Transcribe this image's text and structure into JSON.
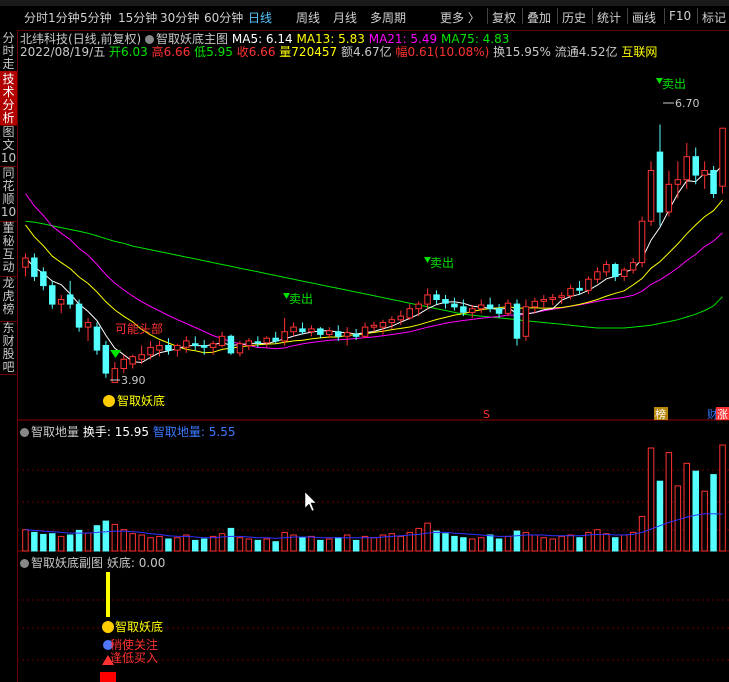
{
  "toolbar": {
    "periods": [
      "分时",
      "1分钟",
      "5分钟",
      "15分钟",
      "30分钟",
      "60分钟",
      "日线",
      "周线",
      "月线",
      "多周期",
      "更多 〉"
    ],
    "active_period": "日线",
    "tools": [
      "复权",
      "叠加",
      "历史",
      "统计",
      "画线",
      "F10",
      "标记"
    ]
  },
  "sidebar": {
    "tabs": [
      "分时走势",
      "技术分析",
      "图文10",
      "同花顺10",
      "董秘互动",
      "龙虎榜",
      "东财股吧"
    ],
    "active": "技术分析"
  },
  "header": {
    "stock": "北纬科技",
    "mode": "(日线,前复权)",
    "indicator": "智取妖底主图",
    "ma5": "MA5: 6.14",
    "ma13": "MA13: 5.83",
    "ma21": "MA21: 5.49",
    "ma75": "MA75: 4.83"
  },
  "quote": {
    "date": "2022/08/19/五",
    "open": "开6.03",
    "high": "高6.66",
    "low": "低5.95",
    "close": "收6.66",
    "volume": "量720457",
    "amount": "额4.67亿",
    "change": "幅0.61(10.08%)",
    "turnover": "换15.95%",
    "float_cap": "流通4.52亿",
    "sector": "互联网"
  },
  "vol_header": {
    "name": "智取地量",
    "turnover": "换手: 15.95",
    "label": "智取地量:",
    "value": "5.55"
  },
  "sub_header": {
    "name": "智取妖底副图",
    "label": "妖底:",
    "value": "0.00"
  },
  "colors": {
    "up": "#ff3232",
    "down": "#54ffff",
    "ma5": "#ffffff",
    "ma13": "#ffff00",
    "ma21": "#ff00ff",
    "ma75": "#00e400",
    "grid": "#6b0000",
    "avg": "#3232ff"
  },
  "chart_data": [
    {
      "type": "candlestick",
      "title": "智取妖底主图",
      "series_names": [
        "MA5",
        "MA13",
        "MA21",
        "MA75"
      ],
      "ylim": [
        3.6,
        7.4
      ],
      "ohlc": [
        [
          5.15,
          5.3,
          5.05,
          5.25
        ],
        [
          5.25,
          5.3,
          5.0,
          5.05
        ],
        [
          5.1,
          5.15,
          4.9,
          4.95
        ],
        [
          4.95,
          5.0,
          4.7,
          4.75
        ],
        [
          4.75,
          4.85,
          4.65,
          4.8
        ],
        [
          4.85,
          5.0,
          4.7,
          4.75
        ],
        [
          4.75,
          4.8,
          4.45,
          4.5
        ],
        [
          4.5,
          4.6,
          4.35,
          4.55
        ],
        [
          4.5,
          4.55,
          4.2,
          4.25
        ],
        [
          4.3,
          4.35,
          3.95,
          4.0
        ],
        [
          3.9,
          4.12,
          3.9,
          4.05
        ],
        [
          4.05,
          4.2,
          4.0,
          4.15
        ],
        [
          4.1,
          4.2,
          4.05,
          4.18
        ],
        [
          4.15,
          4.3,
          4.1,
          4.2
        ],
        [
          4.2,
          4.35,
          4.15,
          4.28
        ],
        [
          4.25,
          4.35,
          4.18,
          4.3
        ],
        [
          4.3,
          4.38,
          4.2,
          4.25
        ],
        [
          4.25,
          4.32,
          4.18,
          4.3
        ],
        [
          4.28,
          4.4,
          4.22,
          4.35
        ],
        [
          4.32,
          4.4,
          4.25,
          4.3
        ],
        [
          4.3,
          4.36,
          4.2,
          4.28
        ],
        [
          4.28,
          4.35,
          4.2,
          4.32
        ],
        [
          4.3,
          4.45,
          4.28,
          4.4
        ],
        [
          4.4,
          4.42,
          4.2,
          4.22
        ],
        [
          4.22,
          4.35,
          4.18,
          4.32
        ],
        [
          4.3,
          4.38,
          4.25,
          4.35
        ],
        [
          4.34,
          4.4,
          4.28,
          4.33
        ],
        [
          4.33,
          4.4,
          4.28,
          4.38
        ],
        [
          4.38,
          4.45,
          4.32,
          4.35
        ],
        [
          4.35,
          4.6,
          4.3,
          4.45
        ],
        [
          4.45,
          4.55,
          4.4,
          4.5
        ],
        [
          4.48,
          4.55,
          4.42,
          4.45
        ],
        [
          4.45,
          4.52,
          4.4,
          4.48
        ],
        [
          4.48,
          4.5,
          4.38,
          4.42
        ],
        [
          4.42,
          4.5,
          4.38,
          4.46
        ],
        [
          4.45,
          4.52,
          4.35,
          4.4
        ],
        [
          4.4,
          4.5,
          4.3,
          4.44
        ],
        [
          4.42,
          4.48,
          4.36,
          4.4
        ],
        [
          4.4,
          4.55,
          4.38,
          4.5
        ],
        [
          4.5,
          4.56,
          4.45,
          4.52
        ],
        [
          4.5,
          4.58,
          4.42,
          4.55
        ],
        [
          4.55,
          4.62,
          4.48,
          4.58
        ],
        [
          4.58,
          4.68,
          4.52,
          4.62
        ],
        [
          4.6,
          4.75,
          4.58,
          4.7
        ],
        [
          4.7,
          4.78,
          4.62,
          4.75
        ],
        [
          4.75,
          4.92,
          4.7,
          4.85
        ],
        [
          4.85,
          4.9,
          4.75,
          4.8
        ],
        [
          4.8,
          4.85,
          4.7,
          4.76
        ],
        [
          4.75,
          4.82,
          4.68,
          4.72
        ],
        [
          4.72,
          4.8,
          4.62,
          4.66
        ],
        [
          4.66,
          4.74,
          4.6,
          4.7
        ],
        [
          4.7,
          4.8,
          4.65,
          4.74
        ],
        [
          4.74,
          4.82,
          4.66,
          4.7
        ],
        [
          4.7,
          4.75,
          4.6,
          4.65
        ],
        [
          4.65,
          4.8,
          4.62,
          4.76
        ],
        [
          4.75,
          4.8,
          4.3,
          4.38
        ],
        [
          4.4,
          4.8,
          4.35,
          4.72
        ],
        [
          4.72,
          4.82,
          4.65,
          4.78
        ],
        [
          4.78,
          4.85,
          4.7,
          4.8
        ],
        [
          4.8,
          4.86,
          4.74,
          4.82
        ],
        [
          4.82,
          4.88,
          4.75,
          4.84
        ],
        [
          4.84,
          4.96,
          4.8,
          4.92
        ],
        [
          4.92,
          5.0,
          4.85,
          4.9
        ],
        [
          4.9,
          5.05,
          4.86,
          5.02
        ],
        [
          5.02,
          5.15,
          4.98,
          5.1
        ],
        [
          5.1,
          5.22,
          5.05,
          5.18
        ],
        [
          5.18,
          5.2,
          5.0,
          5.05
        ],
        [
          5.05,
          5.15,
          5.0,
          5.12
        ],
        [
          5.12,
          5.25,
          5.08,
          5.2
        ],
        [
          5.2,
          5.7,
          5.15,
          5.65
        ],
        [
          5.65,
          6.3,
          5.6,
          6.2
        ],
        [
          6.4,
          6.7,
          5.6,
          5.75
        ],
        [
          5.75,
          6.2,
          5.7,
          6.05
        ],
        [
          6.05,
          6.3,
          5.9,
          6.1
        ],
        [
          6.1,
          6.5,
          6.0,
          6.35
        ],
        [
          6.35,
          6.45,
          6.05,
          6.15
        ],
        [
          6.15,
          6.3,
          6.0,
          6.2
        ],
        [
          6.2,
          6.25,
          5.9,
          5.95
        ],
        [
          6.03,
          6.66,
          5.95,
          6.66
        ]
      ],
      "ma75": [
        5.65,
        5.64,
        5.62,
        5.6,
        5.58,
        5.56,
        5.54,
        5.52,
        5.49,
        5.46,
        5.43,
        5.41,
        5.38,
        5.36,
        5.34,
        5.32,
        5.3,
        5.28,
        5.26,
        5.24,
        5.22,
        5.2,
        5.18,
        5.16,
        5.14,
        5.12,
        5.1,
        5.08,
        5.06,
        5.04,
        5.02,
        5.0,
        4.98,
        4.96,
        4.94,
        4.92,
        4.9,
        4.88,
        4.86,
        4.84,
        4.82,
        4.8,
        4.78,
        4.76,
        4.74,
        4.72,
        4.7,
        4.68,
        4.66,
        4.64,
        4.63,
        4.62,
        4.61,
        4.6,
        4.59,
        4.58,
        4.57,
        4.56,
        4.55,
        4.54,
        4.53,
        4.52,
        4.51,
        4.5,
        4.49,
        4.49,
        4.49,
        4.49,
        4.5,
        4.51,
        4.52,
        4.54,
        4.56,
        4.58,
        4.61,
        4.64,
        4.68,
        4.73,
        4.83
      ]
    },
    {
      "type": "bar",
      "title": "智取地量",
      "series_names": [
        "换手",
        "智取地量"
      ],
      "ylim": [
        0,
        17
      ],
      "values": [
        3.2,
        2.8,
        2.5,
        2.6,
        2.2,
        2.4,
        3.1,
        2.7,
        3.8,
        4.5,
        4.0,
        3.2,
        2.6,
        2.4,
        2.0,
        2.2,
        1.8,
        2.0,
        2.4,
        1.6,
        1.8,
        2.2,
        2.6,
        3.4,
        2.0,
        1.8,
        1.6,
        1.8,
        1.4,
        2.8,
        2.4,
        2.0,
        2.2,
        1.6,
        1.8,
        2.0,
        2.4,
        1.6,
        2.2,
        2.0,
        2.4,
        2.6,
        2.2,
        2.8,
        3.4,
        4.2,
        3.0,
        2.6,
        2.2,
        2.0,
        1.8,
        2.0,
        2.4,
        1.8,
        2.2,
        3.0,
        2.8,
        2.4,
        2.0,
        1.8,
        2.2,
        2.4,
        2.0,
        2.8,
        3.2,
        2.6,
        2.0,
        2.4,
        2.8,
        5.2,
        15.5,
        10.5,
        14.8,
        9.8,
        13.2,
        12.0,
        9.0,
        11.5,
        15.95
      ],
      "avg": [
        3.2,
        3.1,
        3.0,
        2.9,
        2.8,
        2.7,
        2.7,
        2.7,
        2.8,
        2.9,
        3.0,
        3.0,
        2.9,
        2.8,
        2.6,
        2.5,
        2.3,
        2.2,
        2.2,
        2.1,
        2.0,
        2.0,
        2.1,
        2.2,
        2.2,
        2.1,
        2.0,
        2.0,
        1.9,
        2.0,
        2.1,
        2.1,
        2.1,
        2.0,
        2.0,
        2.0,
        2.0,
        2.0,
        2.0,
        2.0,
        2.1,
        2.2,
        2.3,
        2.4,
        2.5,
        2.7,
        2.8,
        2.8,
        2.7,
        2.6,
        2.5,
        2.4,
        2.3,
        2.2,
        2.2,
        2.3,
        2.4,
        2.4,
        2.4,
        2.3,
        2.3,
        2.3,
        2.3,
        2.4,
        2.5,
        2.5,
        2.4,
        2.4,
        2.5,
        2.8,
        3.3,
        3.8,
        4.3,
        4.7,
        5.1,
        5.4,
        5.6,
        5.6,
        5.55
      ]
    }
  ],
  "signals": {
    "sell": "卖出",
    "possible_top": "可能头部",
    "low_price": "3.90",
    "high_price": "6.70",
    "yaodi": "智取妖底",
    "sub_yaodi": "智取妖底",
    "focus": "稍使关注",
    "buy": "逢低买入",
    "mark_s": "S",
    "mark_bang": "榜",
    "mark_cai": "财",
    "mark_zhang": "涨"
  }
}
